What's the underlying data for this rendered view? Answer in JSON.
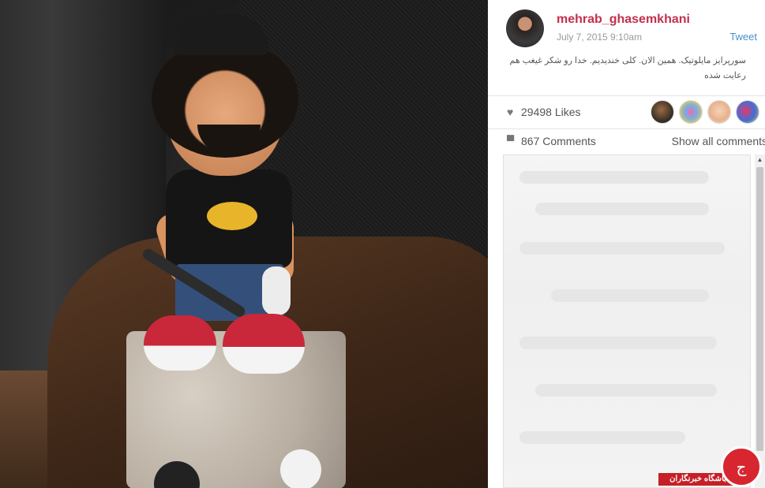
{
  "post": {
    "username": "mehrab_ghasemkhani",
    "timestamp": "July 7, 2015 9:10am",
    "tweet_label": "Tweet",
    "caption": "سورپرایز مایلوتیک. همین الان. کلی خندیدیم. خدا رو شکر غیغب هم رعایت شده"
  },
  "stats": {
    "heart_icon": "♥",
    "likes": "29498 Likes",
    "comment_icon": "▀",
    "comments": "867 Comments",
    "show_all": "Show all comments"
  },
  "scrollbar": {
    "up_arrow": "▲"
  },
  "watermark": {
    "mark": "ج",
    "label": "باشگاه خبرنگاران"
  },
  "colors": {
    "username": "#c1304c",
    "tweet_link": "#4a90c8",
    "watermark_red": "#d7262f"
  },
  "icons": [
    "heart-icon",
    "comment-icon",
    "scroll-up-icon"
  ]
}
